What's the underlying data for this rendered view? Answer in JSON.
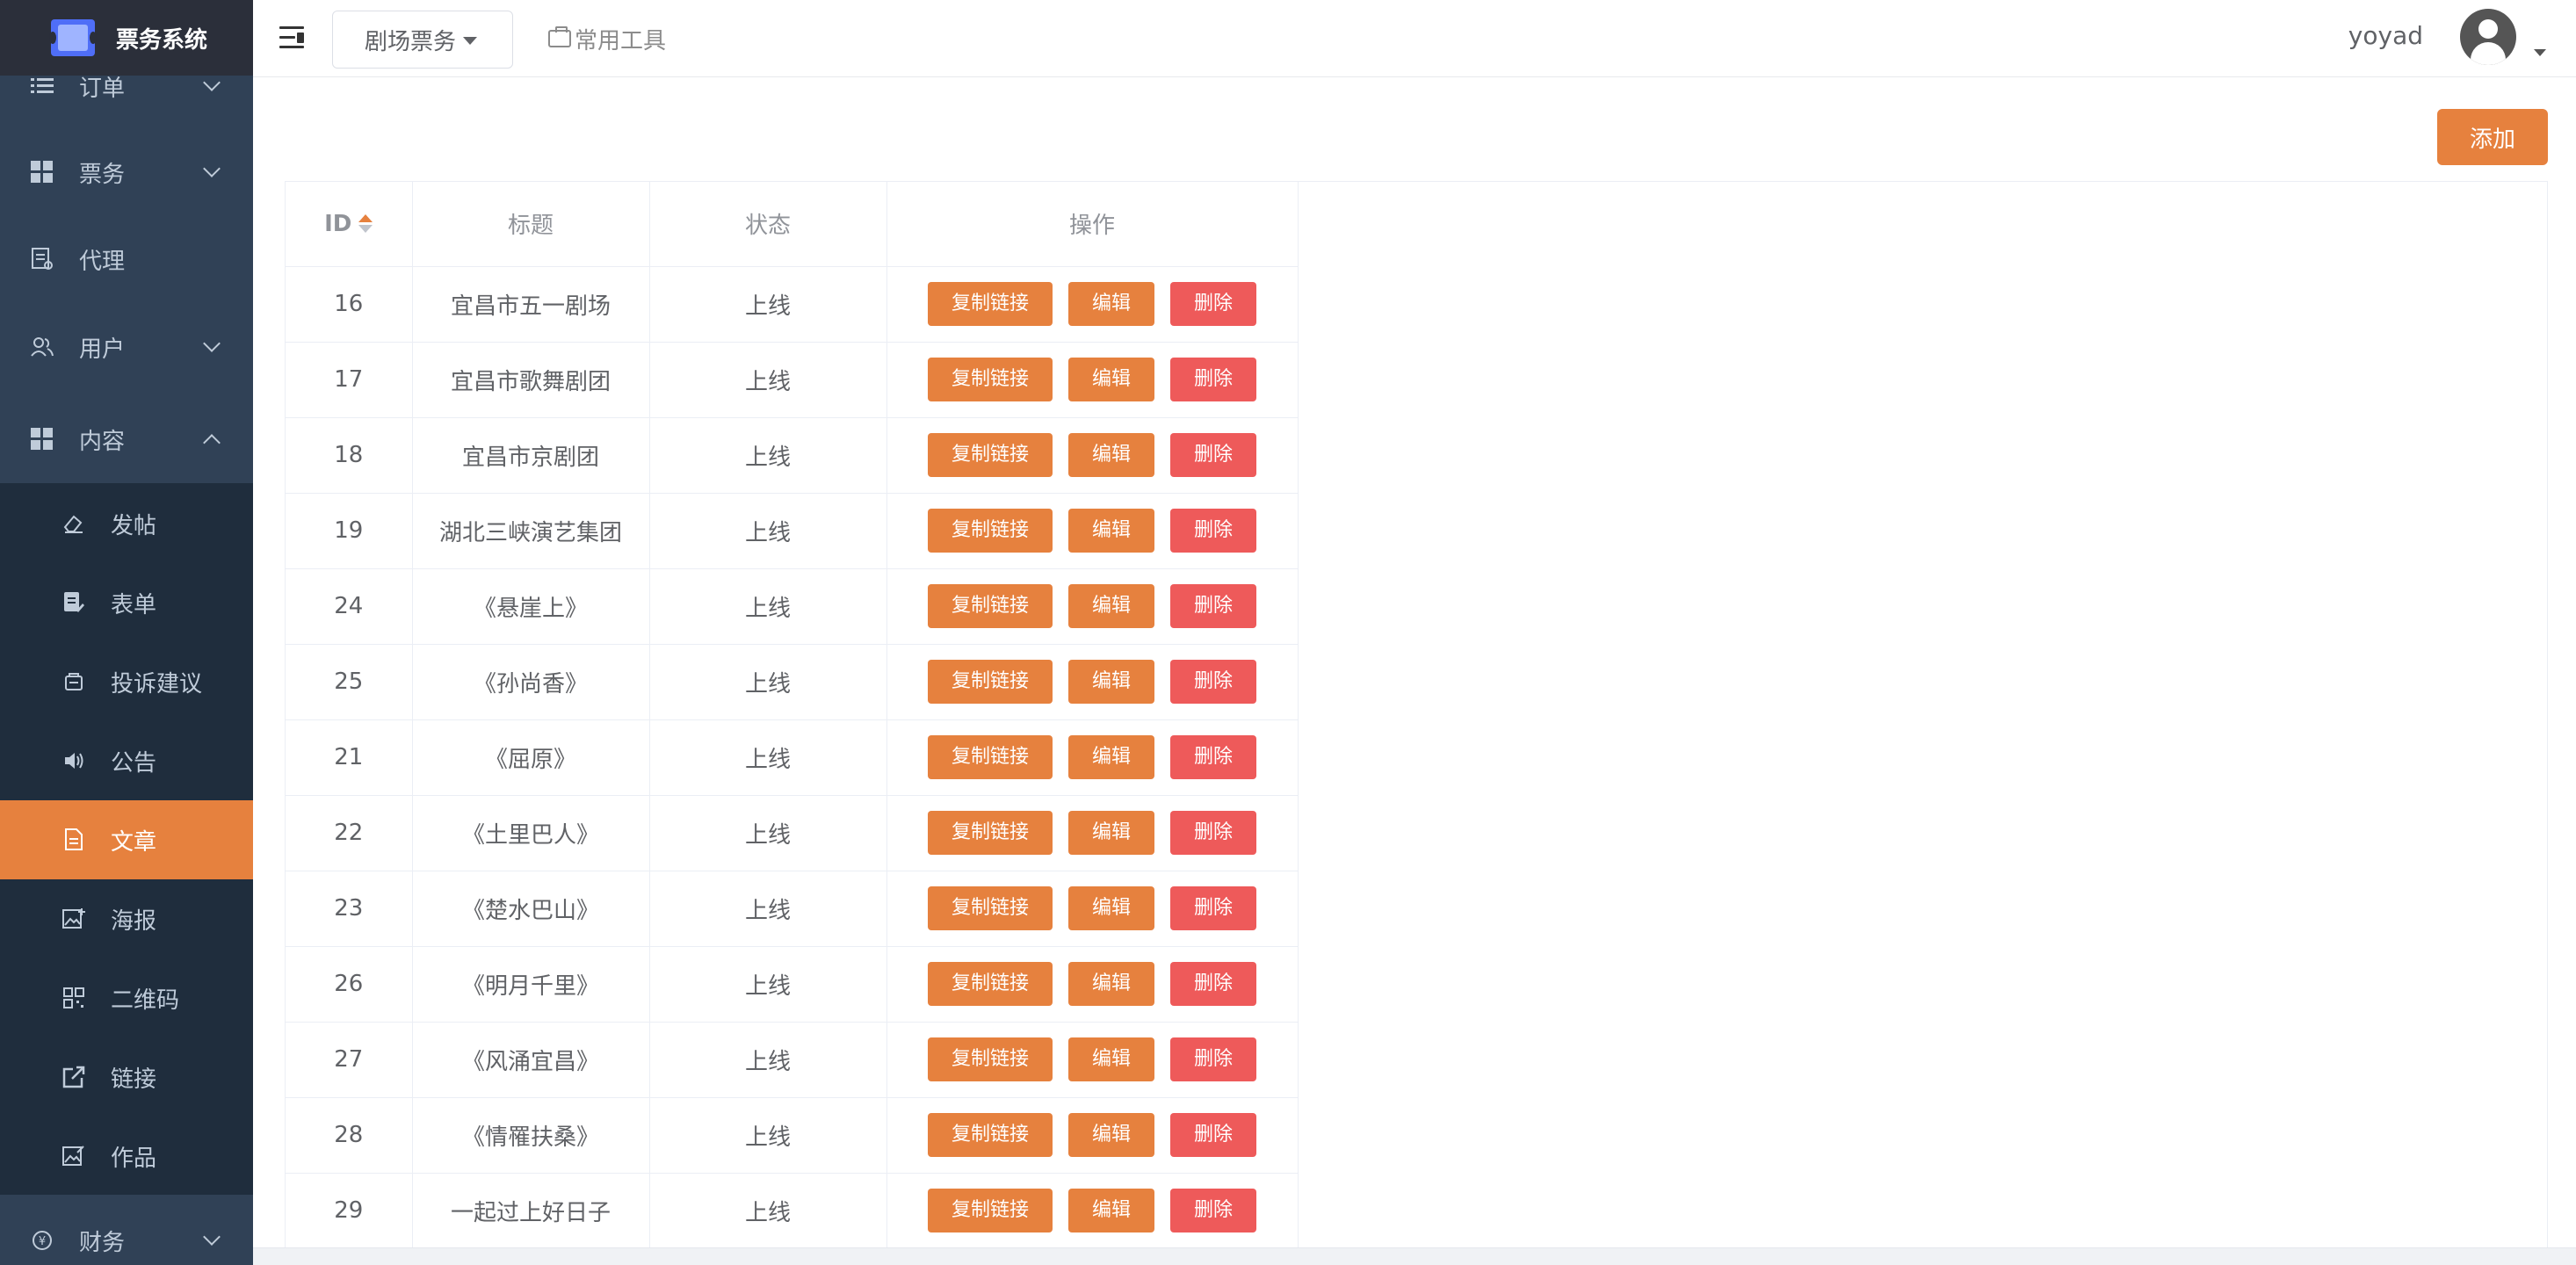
{
  "app": {
    "title": "票务系统"
  },
  "colors": {
    "accent": "#e6813e",
    "danger": "#ee5a5a",
    "sidebar": "#304156"
  },
  "sidebar": {
    "items": [
      {
        "label": "订单",
        "icon": "list-icon"
      },
      {
        "label": "票务",
        "icon": "grid-icon"
      },
      {
        "label": "代理",
        "icon": "document-icon"
      },
      {
        "label": "用户",
        "icon": "users-icon"
      },
      {
        "label": "内容",
        "icon": "grid-icon"
      },
      {
        "label": "财务",
        "icon": "money-icon"
      }
    ],
    "content_sub": [
      {
        "label": "发帖",
        "icon": "eraser-icon"
      },
      {
        "label": "表单",
        "icon": "form-icon"
      },
      {
        "label": "投诉建议",
        "icon": "feedback-icon"
      },
      {
        "label": "公告",
        "icon": "speaker-icon"
      },
      {
        "label": "文章",
        "icon": "article-icon",
        "active": true
      },
      {
        "label": "海报",
        "icon": "poster-icon"
      },
      {
        "label": "二维码",
        "icon": "qrcode-icon"
      },
      {
        "label": "链接",
        "icon": "external-link-icon"
      },
      {
        "label": "作品",
        "icon": "works-icon"
      }
    ]
  },
  "navbar": {
    "theater_select": "剧场票务",
    "tools_label": "常用工具",
    "username": "yoyad"
  },
  "toolbar": {
    "add_label": "添加"
  },
  "table": {
    "headers": {
      "id": "ID",
      "title": "标题",
      "status": "状态",
      "ops": "操作"
    },
    "actions": {
      "copy": "复制链接",
      "edit": "编辑",
      "delete": "删除"
    },
    "rows": [
      {
        "id": "16",
        "title": "宜昌市五一剧场",
        "status": "上线"
      },
      {
        "id": "17",
        "title": "宜昌市歌舞剧团",
        "status": "上线"
      },
      {
        "id": "18",
        "title": "宜昌市京剧团",
        "status": "上线"
      },
      {
        "id": "19",
        "title": "湖北三峡演艺集团",
        "status": "上线"
      },
      {
        "id": "24",
        "title": "《悬崖上》",
        "status": "上线"
      },
      {
        "id": "25",
        "title": "《孙尚香》",
        "status": "上线"
      },
      {
        "id": "21",
        "title": "《屈原》",
        "status": "上线"
      },
      {
        "id": "22",
        "title": "《土里巴人》",
        "status": "上线"
      },
      {
        "id": "23",
        "title": "《楚水巴山》",
        "status": "上线"
      },
      {
        "id": "26",
        "title": "《明月千里》",
        "status": "上线"
      },
      {
        "id": "27",
        "title": "《风涌宜昌》",
        "status": "上线"
      },
      {
        "id": "28",
        "title": "《情罹扶桑》",
        "status": "上线"
      },
      {
        "id": "29",
        "title": "一起过上好日子",
        "status": "上线"
      }
    ]
  }
}
